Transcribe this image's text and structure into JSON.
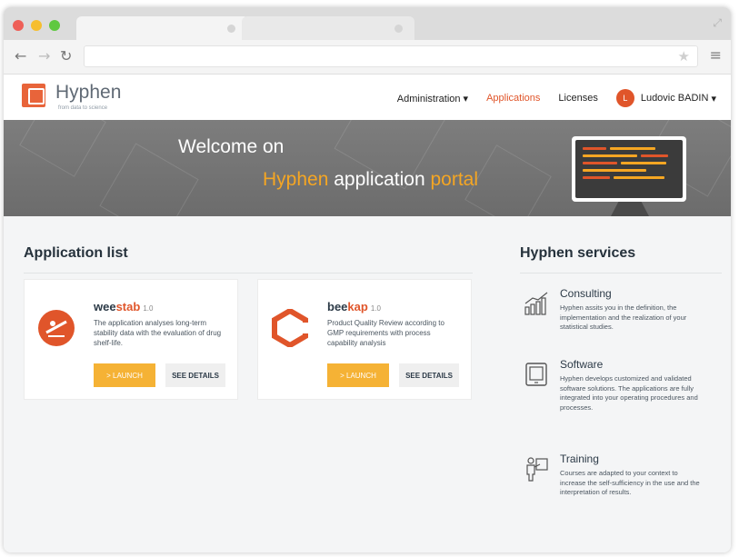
{
  "browser": {
    "url": "",
    "window_dots": [
      "#ee5f57",
      "#f6be2f",
      "#5fc840"
    ]
  },
  "header": {
    "logo_name": "Hyphen",
    "logo_tagline": "from data to science",
    "nav": {
      "administration": "Administration",
      "applications": "Applications",
      "licenses": "Licenses",
      "user_initial": "L",
      "user_name": "Ludovic BADIN"
    }
  },
  "banner": {
    "welcome": "Welcome on",
    "tagline_part1": "Hyphen",
    "tagline_part2": " application ",
    "tagline_part3": "portal"
  },
  "application_list": {
    "title": "Application list",
    "apps": [
      {
        "name_prefix": "wee",
        "name_accent": "stab",
        "version": "1.0",
        "description": "The application analyses long-term stability data with the evaluation of drug shelf-life.",
        "launch_label": "> LAUNCH",
        "details_label": "SEE DETAILS"
      },
      {
        "name_prefix": "bee",
        "name_accent": "kap",
        "version": "1.0",
        "description": "Product Quality Review according to GMP requirements with process capability analysis",
        "launch_label": "> LAUNCH",
        "details_label": "SEE DETAILS"
      }
    ]
  },
  "services": {
    "title": "Hyphen services",
    "items": [
      {
        "icon": "chart-icon",
        "title": "Consulting",
        "description": "Hyphen assits you in the definition, the implementation and the realization of your statistical studies."
      },
      {
        "icon": "tablet-icon",
        "title": "Software",
        "description": "Hyphen develops customized and validated software solutions. The applications are fully integrated into your operating procedures and processes."
      },
      {
        "icon": "presenter-icon",
        "title": "Training",
        "description": "Courses are adapted to your context to increase the self-sufficiency in the use and the interpretation of results."
      }
    ]
  },
  "colors": {
    "accent": "#e0552a",
    "launch": "#f5b235",
    "highlight": "#f5a623"
  }
}
